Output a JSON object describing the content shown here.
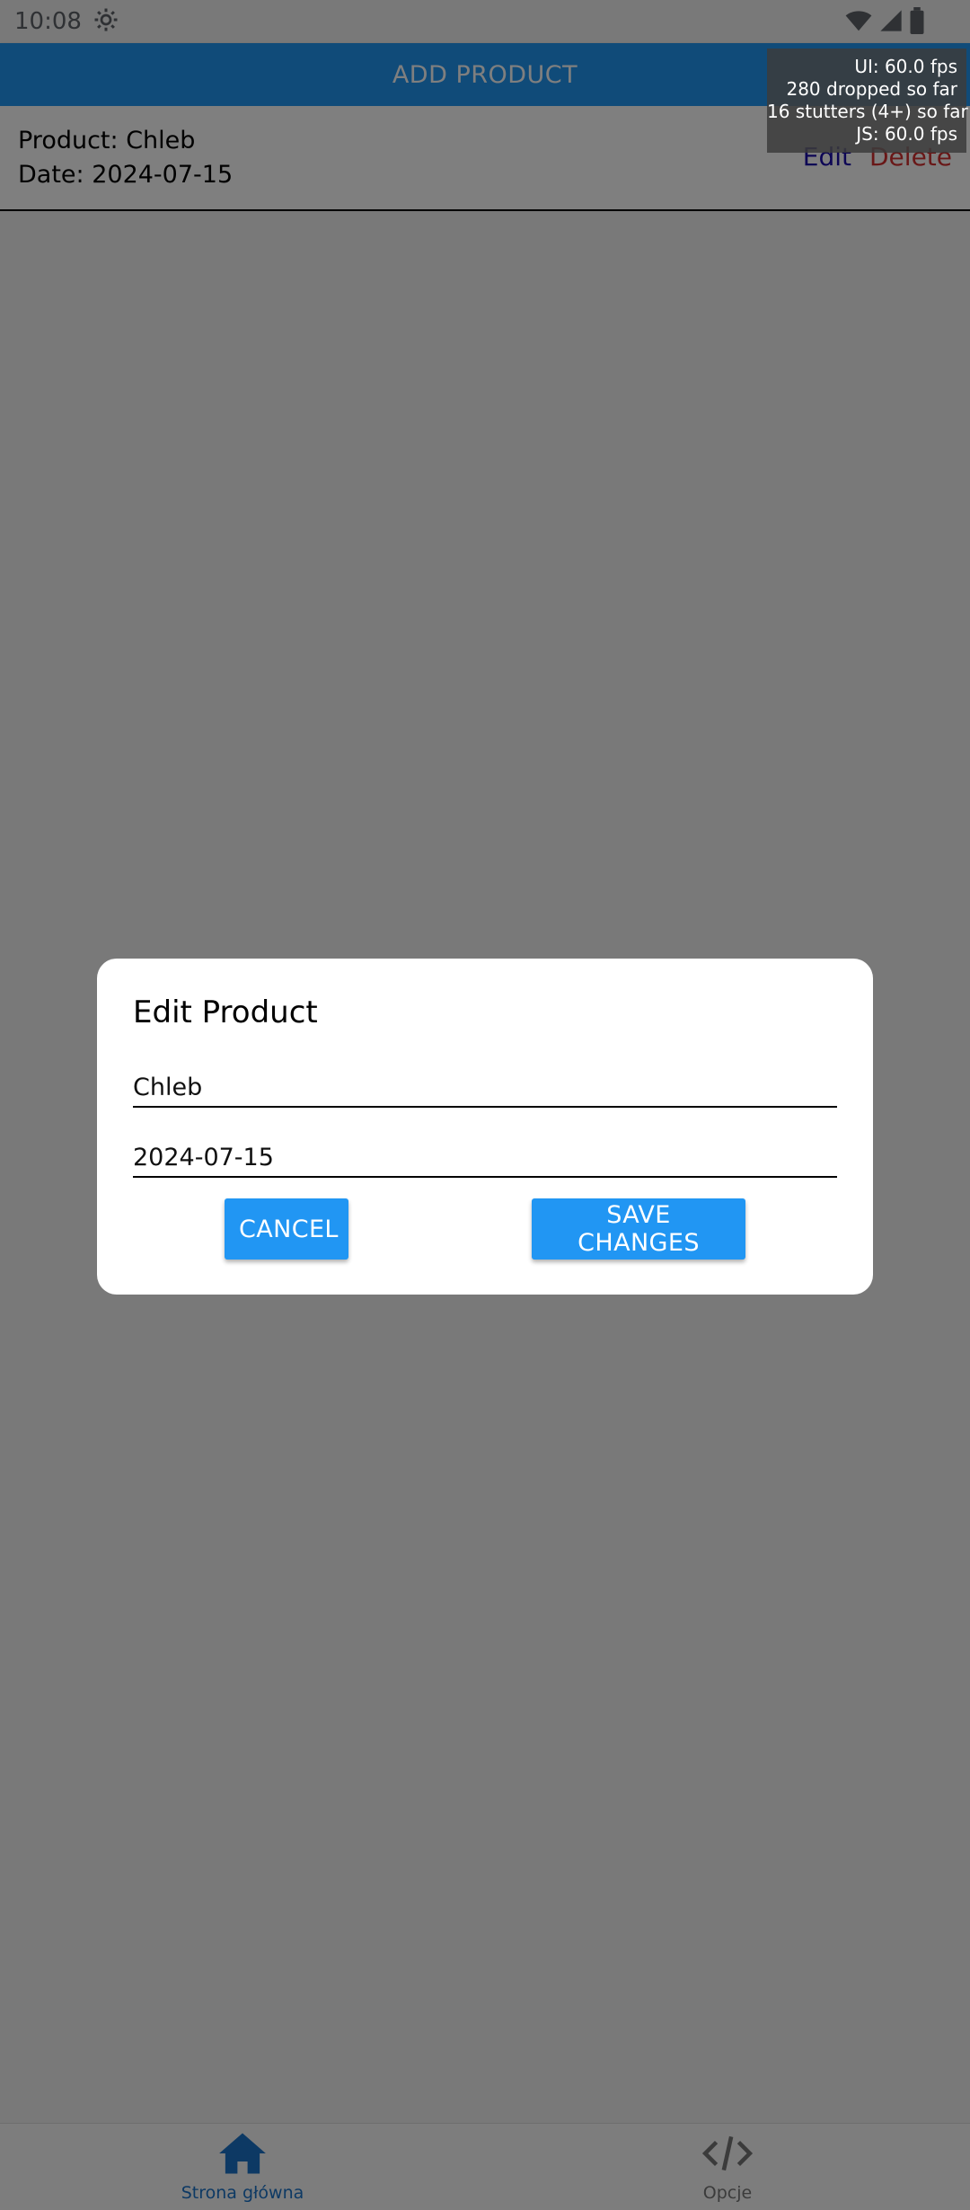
{
  "status_bar": {
    "time": "10:08"
  },
  "app_bar": {
    "title": "ADD PRODUCT"
  },
  "perf_monitor": {
    "ui_fps": "UI: 60.0 fps",
    "dropped": "280 dropped so far",
    "stutters": "16 stutters (4+) so far",
    "js_fps": "JS: 60.0 fps"
  },
  "product_row": {
    "product": "Product: Chleb",
    "date": "Date: 2024-07-15",
    "edit_label": "Edit",
    "delete_label": "Delete"
  },
  "dialog": {
    "title": "Edit Product",
    "name_value": "Chleb",
    "date_value": "2024-07-15",
    "cancel_label": "CANCEL",
    "save_label": "SAVE CHANGES"
  },
  "bottom_nav": {
    "items": [
      {
        "label": "Strona główna",
        "icon": "home-icon",
        "active": true
      },
      {
        "label": "Opcje",
        "icon": "code-icon",
        "active": false
      }
    ]
  },
  "colors": {
    "primary": "#2196f3",
    "edit_link": "#1a0dab",
    "delete_link": "#d32f2f",
    "active_nav": "#1a73c8"
  }
}
